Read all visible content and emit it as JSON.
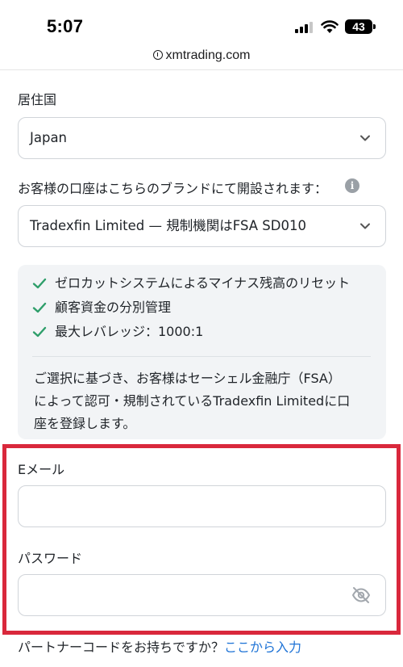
{
  "status_bar": {
    "time": "5:07",
    "battery": "43"
  },
  "browser": {
    "url": "xmtrading.com"
  },
  "form": {
    "country_label": "居住国",
    "country_value": "Japan",
    "brand_label": "お客様の口座はこちらのブランドにて開設されます：",
    "brand_value": "Tradexfin Limited — 規制機関はFSA SD010",
    "info_icon": "i",
    "features": [
      "ゼロカットシステムによるマイナス残高のリセット",
      "顧客資金の分別管理",
      "最大レバレッジ：1000:1"
    ],
    "description_lines": [
      "ご選択に基づき、お客様はセーシェル金融庁（FSA）",
      "によって認可・規制されているTradexfin Limitedに口",
      "座を登録します。"
    ],
    "email_label": "Eメール",
    "email_value": "",
    "password_label": "パスワード",
    "password_value": "",
    "partner_text": "パートナーコードをお持ちですか？",
    "partner_link": "ここから入力"
  },
  "colors": {
    "highlight": "#d9283c",
    "check": "#2e9e6a",
    "link": "#1e73d6",
    "panel_bg": "#f2f4f6"
  },
  "icons": {
    "features": "check-icon",
    "select": "chevron-down-icon",
    "password_toggle": "eye-off-icon",
    "brand_info": "info-icon"
  }
}
